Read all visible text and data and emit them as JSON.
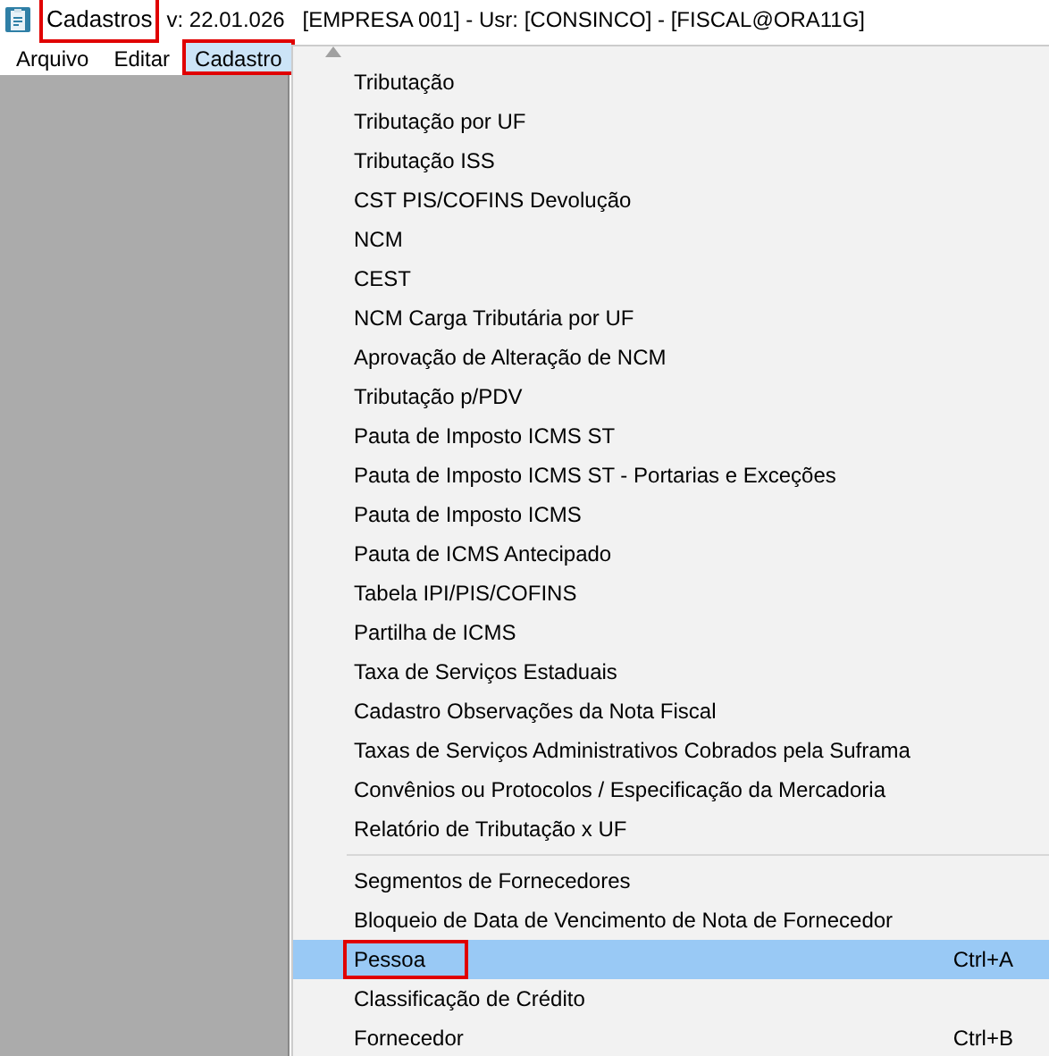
{
  "window": {
    "title": "Cadastros",
    "title_marked": true,
    "subtitle": "v: 22.01.026   [EMPRESA 001] - Usr: [CONSINCO] - [FISCAL@ORA11G]"
  },
  "menu_bar": [
    {
      "label": "Arquivo",
      "selected": false,
      "marked": false
    },
    {
      "label": "Editar",
      "selected": false,
      "marked": false
    },
    {
      "label": "Cadastro",
      "selected": true,
      "marked": true
    }
  ],
  "menu": [
    {
      "kind": "item",
      "label": "Tributação",
      "selected": false,
      "marked": false
    },
    {
      "kind": "item",
      "label": "Tributação por UF",
      "selected": false,
      "marked": false
    },
    {
      "kind": "item",
      "label": "Tributação ISS",
      "selected": false,
      "marked": false
    },
    {
      "kind": "item",
      "label": "CST PIS/COFINS Devolução",
      "selected": false,
      "marked": false
    },
    {
      "kind": "item",
      "label": "NCM",
      "selected": false,
      "marked": false
    },
    {
      "kind": "item",
      "label": "CEST",
      "selected": false,
      "marked": false
    },
    {
      "kind": "item",
      "label": "NCM Carga Tributária por UF",
      "selected": false,
      "marked": false
    },
    {
      "kind": "item",
      "label": "Aprovação de Alteração de NCM",
      "selected": false,
      "marked": false
    },
    {
      "kind": "item",
      "label": "Tributação p/PDV",
      "selected": false,
      "marked": false
    },
    {
      "kind": "item",
      "label": "Pauta de Imposto ICMS ST",
      "selected": false,
      "marked": false
    },
    {
      "kind": "item",
      "label": "Pauta de Imposto ICMS ST - Portarias e Exceções",
      "selected": false,
      "marked": false
    },
    {
      "kind": "item",
      "label": "Pauta de Imposto ICMS",
      "selected": false,
      "marked": false
    },
    {
      "kind": "item",
      "label": "Pauta de ICMS Antecipado",
      "selected": false,
      "marked": false
    },
    {
      "kind": "item",
      "label": "Tabela IPI/PIS/COFINS",
      "selected": false,
      "marked": false
    },
    {
      "kind": "item",
      "label": "Partilha de ICMS",
      "selected": false,
      "marked": false
    },
    {
      "kind": "item",
      "label": "Taxa de Serviços Estaduais",
      "selected": false,
      "marked": false
    },
    {
      "kind": "item",
      "label": "Cadastro Observações da Nota Fiscal",
      "selected": false,
      "marked": false
    },
    {
      "kind": "item",
      "label": "Taxas de Serviços Administrativos Cobrados pela Suframa",
      "selected": false,
      "marked": false
    },
    {
      "kind": "item",
      "label": "Convênios ou Protocolos / Especificação da Mercadoria",
      "selected": false,
      "marked": false
    },
    {
      "kind": "item",
      "label": "Relatório de Tributação x UF",
      "selected": false,
      "marked": false
    },
    {
      "kind": "separator"
    },
    {
      "kind": "item",
      "label": "Segmentos de Fornecedores",
      "selected": false,
      "marked": false
    },
    {
      "kind": "item",
      "label": "Bloqueio de Data de Vencimento de Nota de Fornecedor",
      "selected": false,
      "marked": false
    },
    {
      "kind": "item",
      "label": "Pessoa",
      "shortcut": "Ctrl+A",
      "selected": true,
      "marked": true
    },
    {
      "kind": "item",
      "label": "Classificação de Crédito",
      "selected": false,
      "marked": false
    },
    {
      "kind": "item",
      "label": "Fornecedor",
      "shortcut": "Ctrl+B",
      "selected": false,
      "marked": false
    }
  ]
}
